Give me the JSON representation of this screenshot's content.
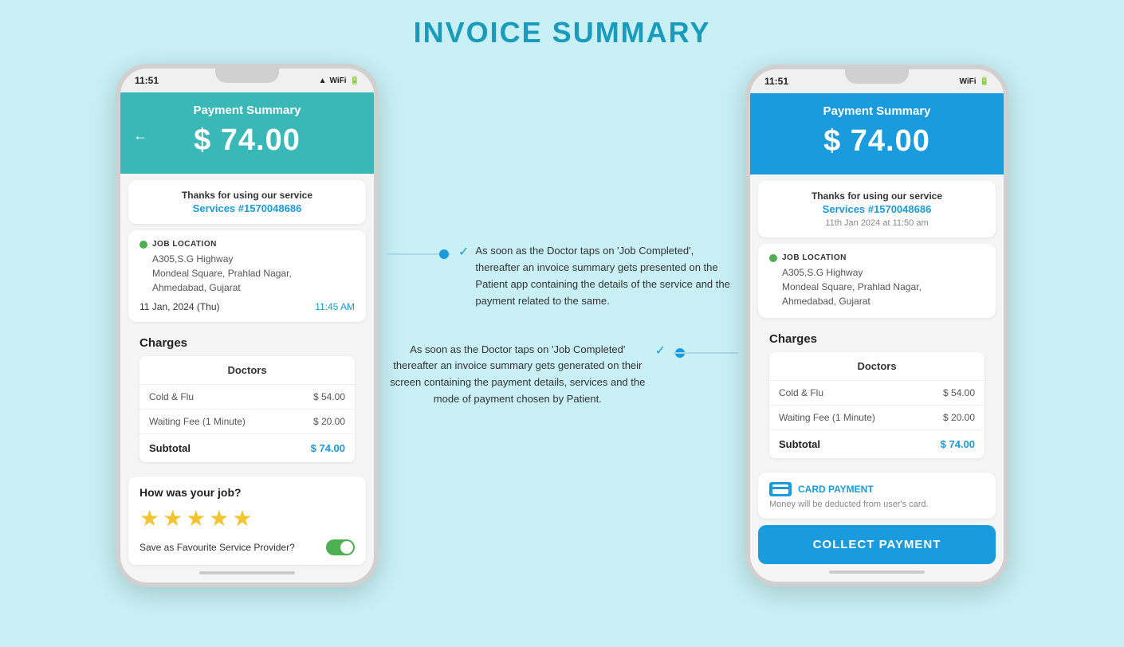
{
  "page": {
    "title": "INVOICE SUMMARY",
    "background": "#c8f0f5"
  },
  "left_phone": {
    "status_time": "11:51",
    "header_title": "Payment Summary",
    "amount": "$ 74.00",
    "service_label": "Thanks for using our service",
    "service_id": "Services #1570048686",
    "location_title": "JOB LOCATION",
    "address_line1": "A305,S.G Highway",
    "address_line2": "Mondeal Square, Prahlad Nagar,",
    "address_line3": "Ahmedabad, Gujarat",
    "date": "11 Jan, 2024 (Thu)",
    "time": "11:45 AM",
    "charges_title": "Charges",
    "doctors_label": "Doctors",
    "charge1_name": "Cold & Flu",
    "charge1_amount": "$ 54.00",
    "charge2_name": "Waiting Fee (1 Minute)",
    "charge2_amount": "$ 20.00",
    "subtotal_label": "Subtotal",
    "subtotal_amount": "$ 74.00",
    "rating_title": "How was your job?",
    "stars": "★★★★★",
    "favourite_label": "Save as Favourite Service Provider?"
  },
  "right_phone": {
    "status_time": "11:51",
    "header_title": "Payment Summary",
    "amount": "$ 74.00",
    "service_label": "Thanks for using our service",
    "service_id": "Services #1570048686",
    "service_date": "11th Jan 2024 at 11:50 am",
    "location_title": "JOB LOCATION",
    "address_line1": "A305,S.G Highway",
    "address_line2": "Mondeal Square, Prahlad Nagar,",
    "address_line3": "Ahmedabad, Gujarat",
    "charges_title": "Charges",
    "doctors_label": "Doctors",
    "charge1_name": "Cold & Flu",
    "charge1_amount": "$ 54.00",
    "charge2_name": "Waiting Fee (1 Minute)",
    "charge2_amount": "$ 20.00",
    "subtotal_label": "Subtotal",
    "subtotal_amount": "$ 74.00",
    "payment_method_label": "CARD PAYMENT",
    "payment_desc": "Money will be deducted from user's card.",
    "collect_button": "COLLECT PAYMENT"
  },
  "annotations": {
    "top_text": "As soon as the Doctor taps on 'Job Completed', thereafter an invoice summary gets presented on the Patient app containing the details of the service and the payment related to the same.",
    "bottom_text": "As soon as the Doctor taps on 'Job Completed' thereafter an invoice summary gets generated on their screen containing the payment details, services and the mode of payment chosen by Patient."
  }
}
